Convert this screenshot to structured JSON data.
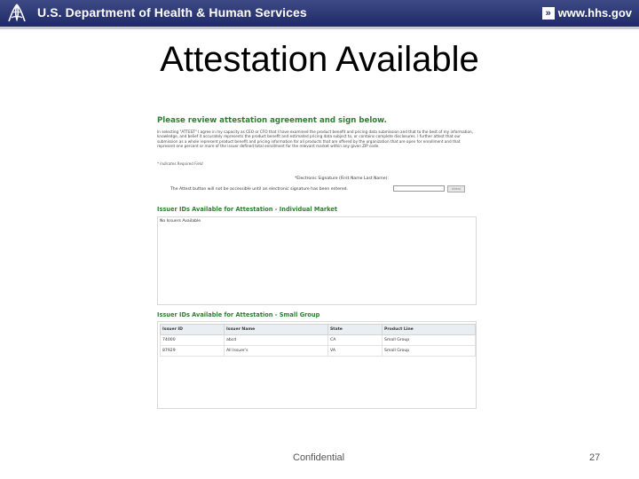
{
  "banner": {
    "logo_icon": "hhs-eagle-icon",
    "department": "U.S. Department of Health & Human Services",
    "url_icon": "arrow-right-icon",
    "url_arrow_glyph": "»",
    "url": "www.hhs.gov",
    "colors": {
      "background": "#1f2a66",
      "text": "#ffffff"
    }
  },
  "slide": {
    "title": "Attestation Available"
  },
  "attestation": {
    "heading": "Please review attestation agreement and sign below.",
    "agreement_text": "In selecting \"ATTEST\" I agree in my capacity as CEO or CFO that I have examined the product benefit and pricing data submission and that to the best of my information, knowledge, and belief it accurately represents the product benefit and estimated pricing data subject to, or contains complete disclosures. I further attest that our submission as a whole represent product benefit and pricing information for all products that are offered by the organization that are open for enrollment and that represent one percent or more of the issuer defined total enrollment for the relevant market within any given ZIP code.",
    "required_note": "* Indicates Required Field",
    "signature_label": "*Electronic Signature (First Name Last Name):",
    "signature_value": "",
    "button_note": "The Attest button will not be accessible until an electronic signature has been entered.",
    "sign_button_label": "Attest"
  },
  "individual_market": {
    "heading": "Issuer IDs Available for Attestation - Individual Market",
    "empty_text": "No Issuers Available"
  },
  "small_group": {
    "heading": "Issuer IDs Available for Attestation - Small Group",
    "columns": [
      "Issuer ID",
      "Issuer Name",
      "State",
      "Product Line"
    ],
    "rows": [
      [
        "74000",
        "abcd",
        "CA",
        "Small Group"
      ],
      [
        "87929",
        "All Issuer's",
        "VA",
        "Small Group"
      ]
    ]
  },
  "footer": {
    "confidential": "Confidential",
    "page_number": "27"
  },
  "colors": {
    "section_heading": "#2e7d32",
    "table_header": "#e9eef3"
  }
}
